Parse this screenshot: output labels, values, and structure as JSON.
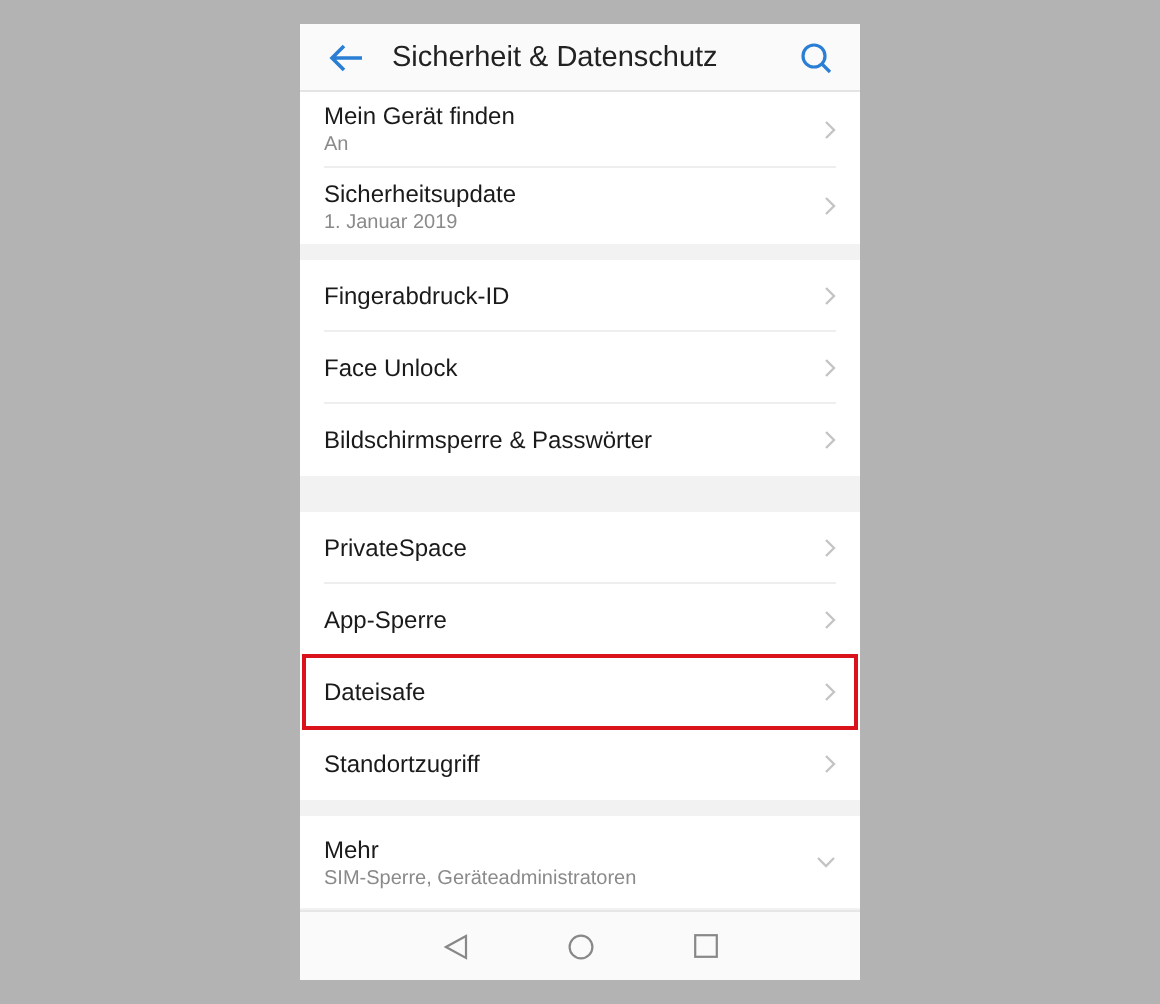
{
  "header": {
    "title": "Sicherheit & Datenschutz"
  },
  "groups": [
    {
      "items": [
        {
          "title": "Mein Gerät finden",
          "subtitle": "An",
          "kind": "link",
          "highlighted": false
        },
        {
          "title": "Sicherheitsupdate",
          "subtitle": "1. Januar 2019",
          "kind": "link",
          "highlighted": false
        }
      ]
    },
    {
      "items": [
        {
          "title": "Fingerabdruck-ID",
          "kind": "link",
          "highlighted": false
        },
        {
          "title": "Face Unlock",
          "kind": "link",
          "highlighted": false
        },
        {
          "title": "Bildschirmsperre & Passwörter",
          "kind": "link",
          "highlighted": false
        }
      ]
    },
    {
      "items": [
        {
          "title": "PrivateSpace",
          "kind": "link",
          "highlighted": false
        },
        {
          "title": "App-Sperre",
          "kind": "link",
          "highlighted": false
        },
        {
          "title": "Dateisafe",
          "kind": "link",
          "highlighted": true
        },
        {
          "title": "Standortzugriff",
          "kind": "link",
          "highlighted": false
        }
      ]
    },
    {
      "items": [
        {
          "title": "Mehr",
          "subtitle": "SIM-Sperre, Geräteadministratoren",
          "kind": "expand",
          "highlighted": false
        }
      ]
    }
  ]
}
